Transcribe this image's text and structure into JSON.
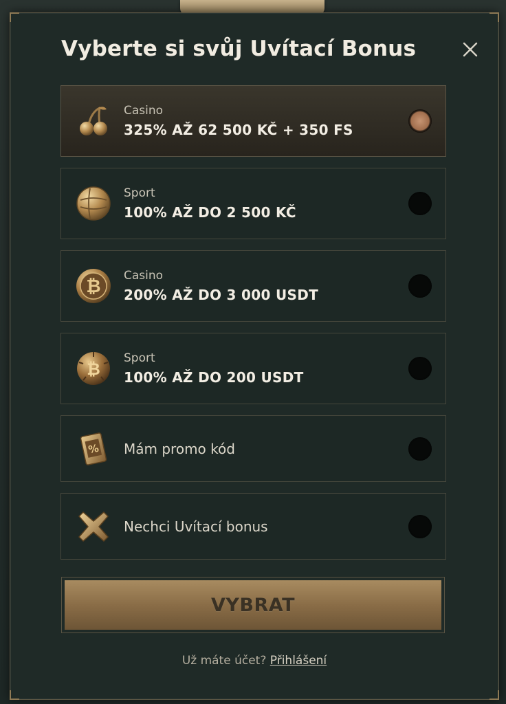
{
  "modal": {
    "title": "Vyberte si svůj Uvítací Bonus",
    "close_icon": "close-icon"
  },
  "options": [
    {
      "category": "Casino",
      "value": "325% AŽ 62 500 KČ + 350 FS",
      "icon": "cherries-icon",
      "selected": true
    },
    {
      "category": "Sport",
      "value": "100% AŽ DO 2 500 KČ",
      "icon": "soccer-ball-icon",
      "selected": false
    },
    {
      "category": "Casino",
      "value": "200% AŽ DO 3 000 USDT",
      "icon": "bitcoin-coin-icon",
      "selected": false
    },
    {
      "category": "Sport",
      "value": "100% AŽ DO 200 USDT",
      "icon": "bitcoin-ball-icon",
      "selected": false
    },
    {
      "label": "Mám promo kód",
      "icon": "promo-ticket-icon",
      "selected": false
    },
    {
      "label": "Nechci Uvítací bonus",
      "icon": "cross-icon",
      "selected": false
    }
  ],
  "cta": {
    "label": "VYBRAT"
  },
  "login": {
    "prompt": "Už máte účet?",
    "link": "Přihlášení"
  },
  "colors": {
    "accent_gold": "#a88b60",
    "background": "#1f2a27",
    "text": "#f1ece1"
  }
}
